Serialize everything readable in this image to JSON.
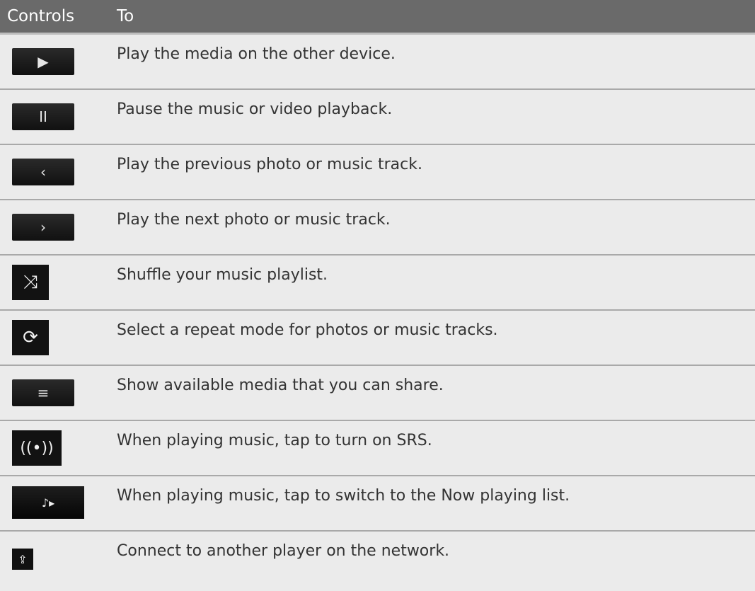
{
  "header": {
    "col_controls": "Controls",
    "col_to": "To"
  },
  "rows": [
    {
      "icon": "play-icon",
      "text": "Play the media on the other device."
    },
    {
      "icon": "pause-icon",
      "text": "Pause the music or video playback."
    },
    {
      "icon": "previous-icon",
      "text": "Play the previous photo or music track."
    },
    {
      "icon": "next-icon",
      "text": "Play the next photo or music track."
    },
    {
      "icon": "shuffle-icon",
      "text": "Shuffle your music playlist."
    },
    {
      "icon": "repeat-icon",
      "text": "Select a repeat mode for photos or music tracks."
    },
    {
      "icon": "menu-icon",
      "text": "Show available media that you can share."
    },
    {
      "icon": "srs-icon",
      "text": "When playing music, tap to turn on SRS."
    },
    {
      "icon": "now-playing-icon",
      "text": "When playing music, tap to switch to the Now playing list."
    },
    {
      "icon": "connect-player-icon",
      "text": "Connect to another player on the network."
    }
  ],
  "colors": {
    "header_bg": "#6a6a6a",
    "row_bg": "#ebebeb",
    "button_bg": "#111111"
  }
}
